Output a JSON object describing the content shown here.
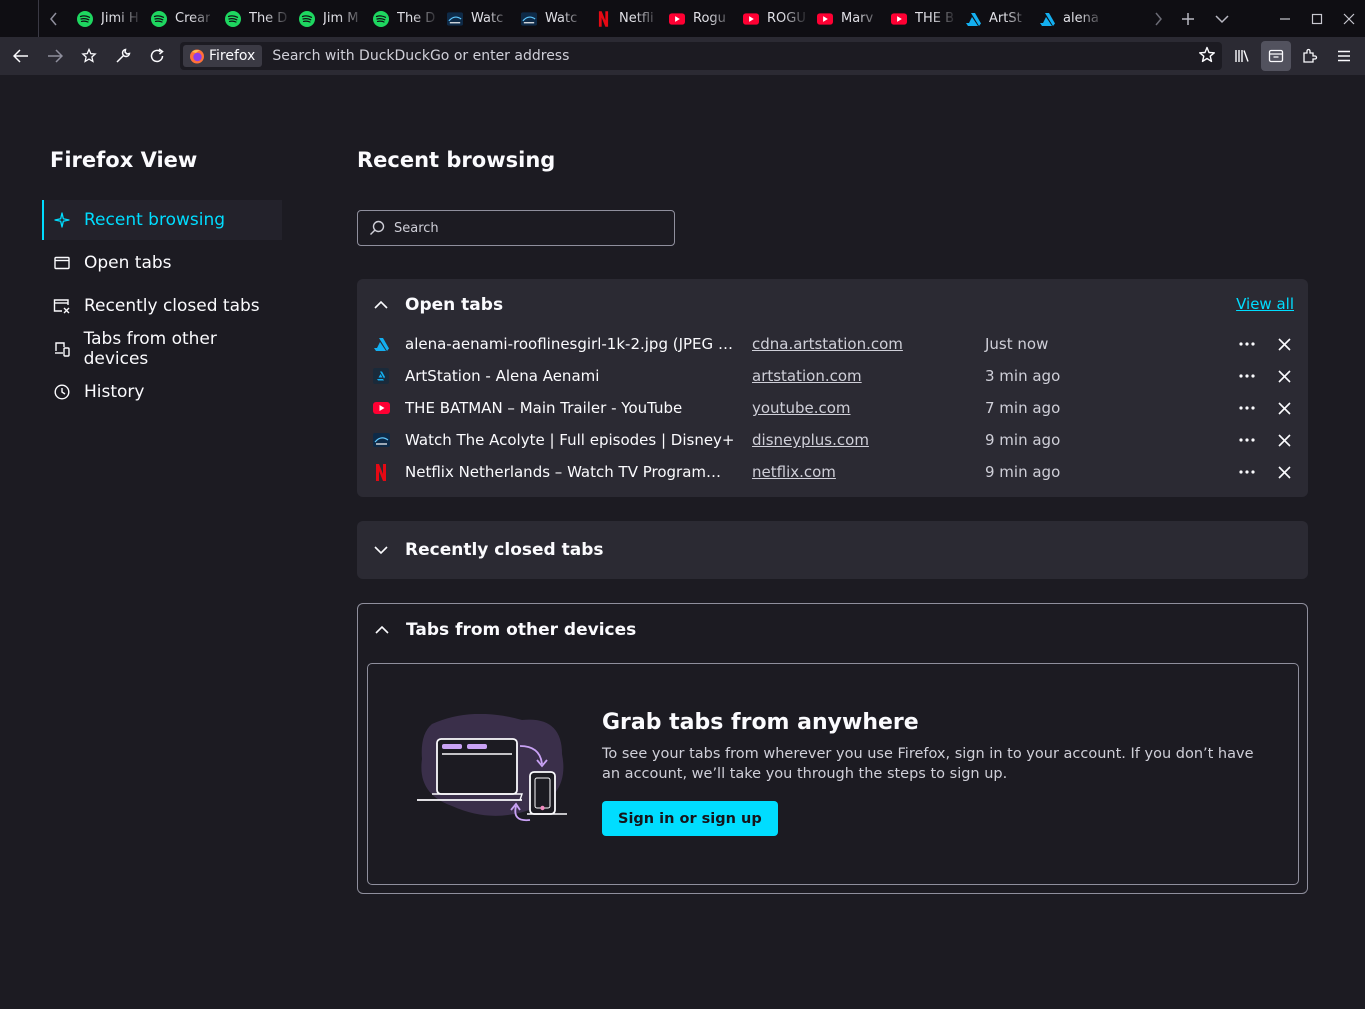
{
  "tabstrip": {
    "tabs": [
      {
        "title": "Jimi H",
        "icon": "spotify-icon"
      },
      {
        "title": "Crear",
        "icon": "spotify-icon"
      },
      {
        "title": "The D",
        "icon": "spotify-icon"
      },
      {
        "title": "Jim M",
        "icon": "spotify-icon"
      },
      {
        "title": "The D",
        "icon": "spotify-icon"
      },
      {
        "title": "Watc",
        "icon": "disney-icon"
      },
      {
        "title": "Watc",
        "icon": "disney-icon"
      },
      {
        "title": "Netfli",
        "icon": "netflix-icon"
      },
      {
        "title": "Rogu",
        "icon": "youtube-icon"
      },
      {
        "title": "ROGU",
        "icon": "youtube-icon"
      },
      {
        "title": "Marv",
        "icon": "youtube-icon"
      },
      {
        "title": "THE B",
        "icon": "youtube-icon"
      },
      {
        "title": "ArtSt",
        "icon": "artstation-icon"
      },
      {
        "title": "alena",
        "icon": "artstation-icon"
      }
    ]
  },
  "navbar": {
    "identity_label": "Firefox",
    "url_placeholder": "Search with DuckDuckGo or enter address"
  },
  "sidebar": {
    "title": "Firefox View",
    "items": [
      {
        "label": "Recent browsing",
        "icon": "sparkle-icon"
      },
      {
        "label": "Open tabs",
        "icon": "tab-icon"
      },
      {
        "label": "Recently closed tabs",
        "icon": "closed-tab-icon"
      },
      {
        "label": "Tabs from other devices",
        "icon": "devices-icon"
      },
      {
        "label": "History",
        "icon": "clock-icon"
      }
    ]
  },
  "main": {
    "title": "Recent browsing",
    "search_placeholder": "Search",
    "open_tabs": {
      "heading": "Open tabs",
      "view_all": "View all",
      "rows": [
        {
          "title": "alena-aenami-rooflinesgirl-1k-2.jpg (JPEG Im...",
          "url": "cdna.artstation.com",
          "time": "Just now",
          "icon": "artstation-icon"
        },
        {
          "title": "ArtStation - Alena Aenami",
          "url": "artstation.com",
          "time": "3 min ago",
          "icon": "artstation-icon"
        },
        {
          "title": "THE BATMAN – Main Trailer - YouTube",
          "url": "youtube.com",
          "time": "7 min ago",
          "icon": "youtube-icon"
        },
        {
          "title": "Watch The Acolyte | Full episodes | Disney+",
          "url": "disneyplus.com",
          "time": "9 min ago",
          "icon": "disney-icon"
        },
        {
          "title": "Netflix Netherlands – Watch TV Programmes ...",
          "url": "netflix.com",
          "time": "9 min ago",
          "icon": "netflix-icon"
        }
      ]
    },
    "recently_closed": {
      "heading": "Recently closed tabs"
    },
    "other_devices": {
      "heading": "Tabs from other devices",
      "promo_heading": "Grab tabs from anywhere",
      "promo_text": "To see your tabs from wherever you use Firefox, sign in to your account. If you don’t have an account, we’ll take you through the steps to sign up.",
      "promo_button": "Sign in or sign up"
    }
  },
  "colors": {
    "accent": "#00ddff",
    "background": "#1c1b22",
    "card": "#2b2a33"
  }
}
